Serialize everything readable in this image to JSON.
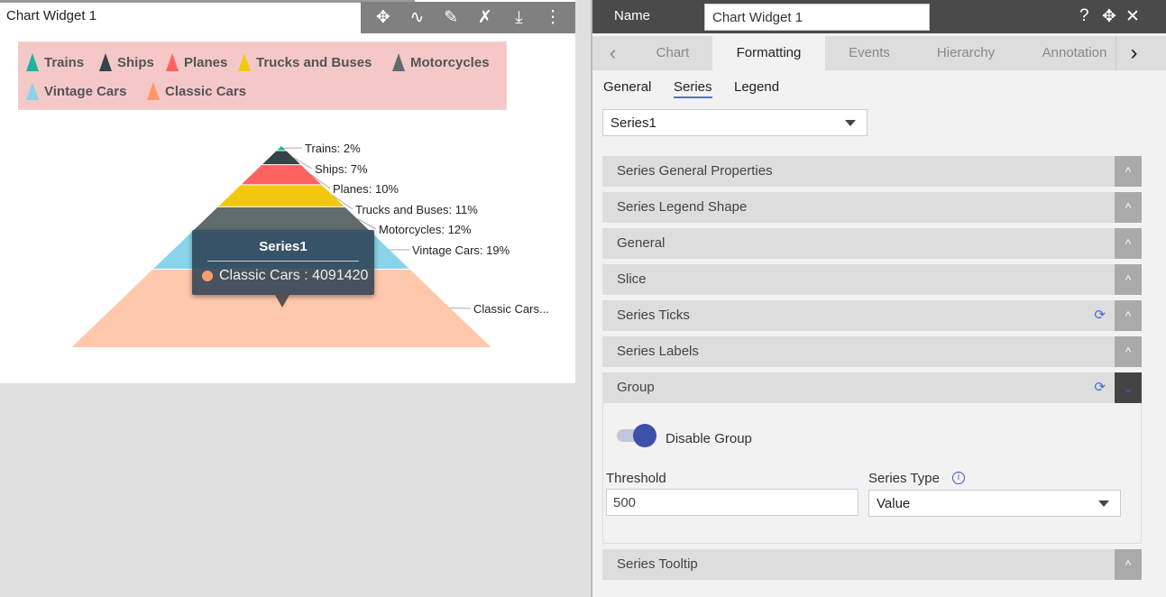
{
  "widget": {
    "title": "Chart Widget 1",
    "toolbar": [
      {
        "icon": "move-icon",
        "glyph": "✥"
      },
      {
        "icon": "link-icon",
        "glyph": "∿"
      },
      {
        "icon": "edit-icon",
        "glyph": "✎"
      },
      {
        "icon": "tools-icon",
        "glyph": "✗"
      },
      {
        "icon": "download-icon",
        "glyph": "⤓"
      },
      {
        "icon": "more-vertical-icon",
        "glyph": "⋮"
      }
    ]
  },
  "chart_data": {
    "type": "pyramid",
    "series_name": "Series1",
    "categories": [
      "Trains",
      "Ships",
      "Planes",
      "Trucks and Buses",
      "Motorcycles",
      "Vintage Cars",
      "Classic Cars"
    ],
    "percent": [
      2,
      7,
      10,
      11,
      12,
      19,
      39
    ],
    "colors": [
      "#1ab39f",
      "#354449",
      "#fe6260",
      "#f2c80f",
      "#5f6b6d",
      "#8ad4eb",
      "#fec8ad"
    ],
    "legend_colors": [
      "#1ab39f",
      "#354449",
      "#fe6260",
      "#f2c80f",
      "#5f6b6d",
      "#8ad4eb",
      "#fe9666"
    ],
    "labels": [
      "Trains: 2%",
      "Ships: 7%",
      "Planes: 10%",
      "Trucks and Buses: 11%",
      "Motorcycles: 12%",
      "Vintage Cars: 19%",
      "Classic Cars..."
    ],
    "legend_background": "#f5c8c8",
    "legend_placement": "top",
    "tooltip": {
      "title": "Series1",
      "text": "Classic Cars : 4091420",
      "color": "#f99c6c"
    }
  },
  "panel": {
    "name_label": "Name",
    "name_value": "Chart Widget 1",
    "tabs": [
      "Chart",
      "Formatting",
      "Events",
      "Hierarchy",
      "Annotation"
    ],
    "active_tab": "Formatting",
    "subtabs": [
      "General",
      "Series",
      "Legend"
    ],
    "active_subtab": "Series",
    "series_select": "Series1",
    "sections": [
      "Series General Properties",
      "Series Legend Shape",
      "General",
      "Slice",
      "Series Ticks",
      "Series Labels",
      "Group",
      "Series Tooltip"
    ],
    "group": {
      "toggle_label": "Disable Group",
      "toggle_on": true,
      "threshold_label": "Threshold",
      "threshold_value": "500",
      "series_type_label": "Series Type",
      "series_type_value": "Value"
    }
  }
}
